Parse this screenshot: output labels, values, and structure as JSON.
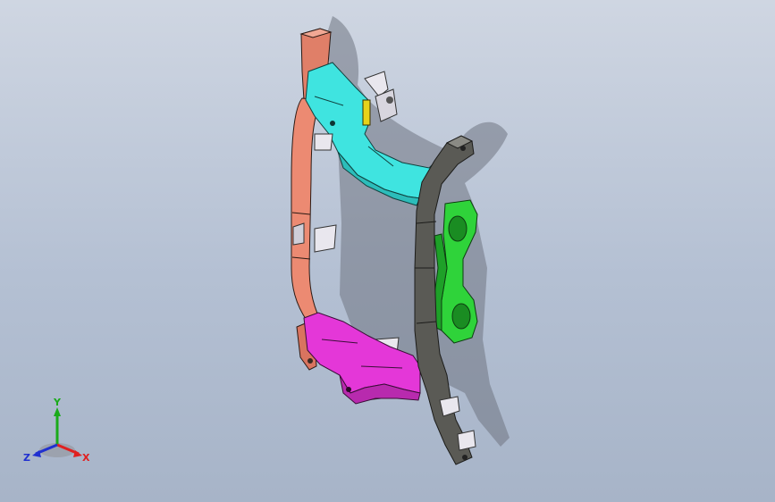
{
  "viewport": {
    "background_top": "#cfd6e2",
    "background_bottom": "#a7b4c8"
  },
  "model": {
    "parts": [
      {
        "name": "left-rail",
        "color": "#ec8a72"
      },
      {
        "name": "upper-crossmember",
        "color": "#3fe4e0"
      },
      {
        "name": "lower-crossmember",
        "color": "#e437d8"
      },
      {
        "name": "right-rail",
        "color": "#5a5a55"
      },
      {
        "name": "right-bracket-plate",
        "color": "#2fd33a"
      },
      {
        "name": "mount-brackets",
        "color": "#e9e7ee"
      },
      {
        "name": "spacer-block",
        "color": "#e7d21a"
      }
    ]
  },
  "triad": {
    "x_label": "X",
    "y_label": "Y",
    "z_label": "Z",
    "x_color": "#e02020",
    "y_color": "#1aaa1a",
    "z_color": "#2030d0"
  }
}
